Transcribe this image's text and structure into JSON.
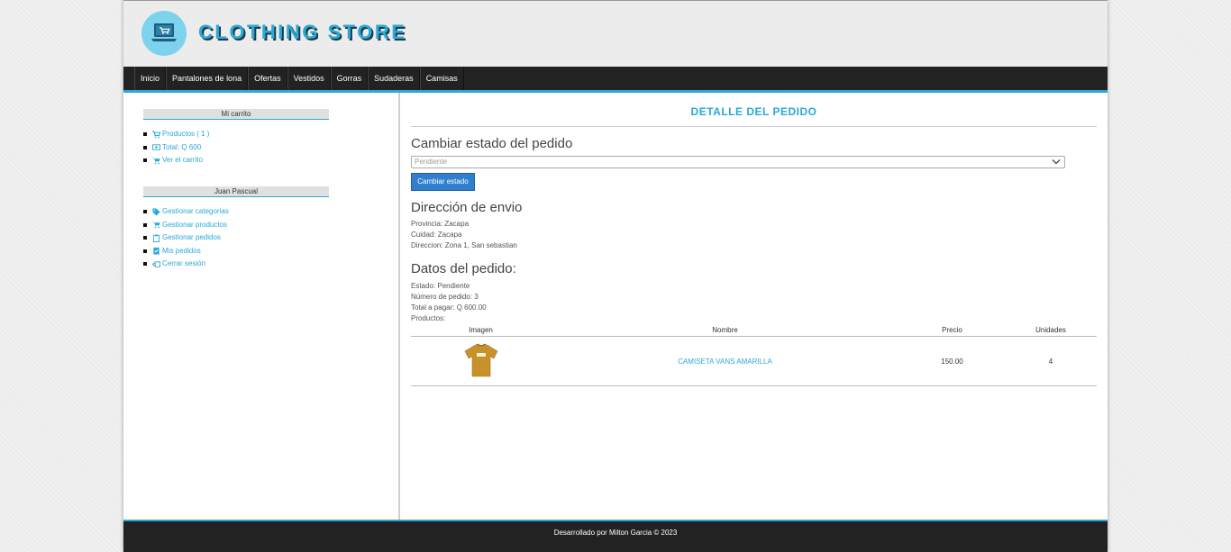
{
  "header": {
    "store_title": "CLOTHING STORE"
  },
  "nav": {
    "items": [
      "Inicio",
      "Pantalones de lona",
      "Ofertas",
      "Vestidos",
      "Gorras",
      "Sudaderas",
      "Camisas"
    ]
  },
  "sidebar": {
    "cart_title": "Mi carrito",
    "cart_items": [
      {
        "label": "Productos ( 1 )",
        "icon": "cart-icon"
      },
      {
        "label": "Total: Q 600",
        "icon": "money-icon"
      },
      {
        "label": "Ver el carrito",
        "icon": "cart-icon"
      }
    ],
    "user_title": "Juan Pascual",
    "user_items": [
      {
        "label": "Gestionar categorias",
        "icon": "tag-icon"
      },
      {
        "label": "Gestionar productos",
        "icon": "cart-icon"
      },
      {
        "label": "Gestionar pedidos",
        "icon": "clipboard-icon"
      },
      {
        "label": "Mis pedidos",
        "icon": "clipboard-check-icon"
      },
      {
        "label": "Cerrar sesión",
        "icon": "logout-icon"
      }
    ]
  },
  "main": {
    "title": "DETALLE DEL PEDIDO",
    "change_status_heading": "Cambiar estado del pedido",
    "status_select_value": "Pendiente",
    "change_status_button": "Cambiar estado",
    "shipping_heading": "Dirección de envio",
    "shipping_lines": [
      "Provincia: Zacapa",
      "Cuidad: Zacapa",
      "Direccion: Zona 1, San sebastian"
    ],
    "order_heading": "Datos del pedido:",
    "order_lines": [
      "Estado: Pendiente",
      "Número de pedido: 3",
      "Total a pagar: Q 600.00",
      "Productos:"
    ],
    "table": {
      "headers": [
        "Imagen",
        "Nombre",
        "Precio",
        "Unidades"
      ],
      "rows": [
        {
          "image": "yellow-tshirt",
          "name": "CAMISETA VANS AMARILLA",
          "price": "150.00",
          "units": "4"
        }
      ]
    }
  },
  "footer": {
    "text": "Desarrollado por Milton Garcia © 2023"
  },
  "colors": {
    "accent": "#29a9d6",
    "nav_bg": "#222222",
    "button": "#2f7fce"
  }
}
